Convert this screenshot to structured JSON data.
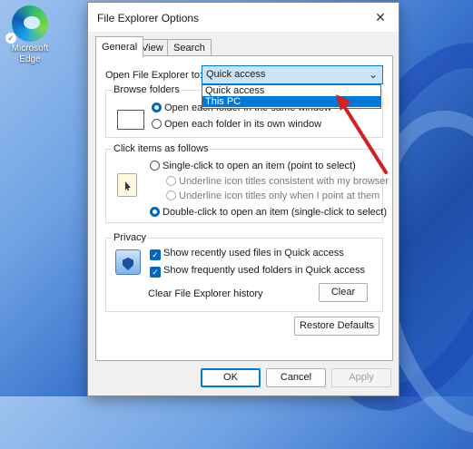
{
  "desktop": {
    "icon_label_line1": "Microsoft",
    "icon_label_line2": "Edge"
  },
  "dialog": {
    "title": "File Explorer Options",
    "close_glyph": "✕"
  },
  "tabs": [
    "General",
    "View",
    "Search"
  ],
  "general": {
    "open_label": "Open File Explorer to:",
    "combo_value": "Quick access",
    "combo_arrow": "⌄",
    "dropdown_options": [
      "Quick access",
      "This PC"
    ],
    "browse": {
      "label": "Browse folders",
      "option_same": "Open each folder in the same window",
      "option_own": "Open each folder in its own window"
    },
    "click_items": {
      "label": "Click items as follows",
      "single": "Single-click to open an item (point to select)",
      "underline_consistent": "Underline icon titles consistent with my browser",
      "underline_point": "Underline icon titles only when I point at them",
      "double": "Double-click to open an item (single-click to select)"
    },
    "privacy": {
      "label": "Privacy",
      "recent_files": "Show recently used files in Quick access",
      "frequent_folders": "Show frequently used folders in Quick access",
      "clear_history": "Clear File Explorer history",
      "clear_button": "Clear"
    },
    "restore_defaults": "Restore Defaults"
  },
  "buttons": {
    "ok": "OK",
    "cancel": "Cancel",
    "apply": "Apply"
  },
  "colors": {
    "accent": "#0078d7",
    "annotation_arrow": "#d42020"
  }
}
